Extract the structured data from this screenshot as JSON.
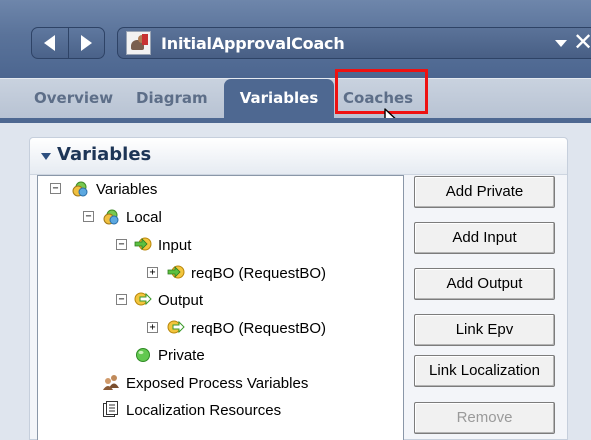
{
  "titlebar": {
    "document_title": "InitialApprovalCoach",
    "back_icon": "triangle-left",
    "forward_icon": "triangle-right",
    "dropdown_icon": "triangle-down",
    "close_icon": "x-close",
    "close_glyph": "✕"
  },
  "tabs": [
    {
      "label": "Overview",
      "active": false
    },
    {
      "label": "Diagram",
      "active": false
    },
    {
      "label": "Variables",
      "active": true
    },
    {
      "label": "Coaches",
      "active": false,
      "highlighted": true
    }
  ],
  "section": {
    "title": "Variables",
    "tree": [
      {
        "label": "Variables",
        "toggle": "−",
        "icon": "variables-icon"
      },
      {
        "label": "Local",
        "toggle": "−",
        "icon": "variables-icon"
      },
      {
        "label": "Input",
        "toggle": "−",
        "icon": "input-arrow-icon"
      },
      {
        "label": "reqBO (RequestBO)",
        "toggle": "+",
        "icon": "input-arrow-icon"
      },
      {
        "label": "Output",
        "toggle": "−",
        "icon": "output-arrow-icon"
      },
      {
        "label": "reqBO (RequestBO)",
        "toggle": "+",
        "icon": "output-arrow-icon"
      },
      {
        "label": "Private",
        "toggle": "",
        "icon": "private-icon"
      },
      {
        "label": "Exposed Process Variables",
        "toggle": "",
        "icon": "users-icon"
      },
      {
        "label": "Localization Resources",
        "toggle": "",
        "icon": "resources-icon"
      }
    ],
    "buttons": {
      "add_private": "Add Private",
      "add_input": "Add Input",
      "add_output": "Add Output",
      "link_epv": "Link Epv",
      "link_localization": "Link Localization",
      "remove": "Remove"
    }
  },
  "colors": {
    "titlebar": "#5a739a",
    "active_tab": "#4e6891",
    "highlight": "#ee1111"
  }
}
